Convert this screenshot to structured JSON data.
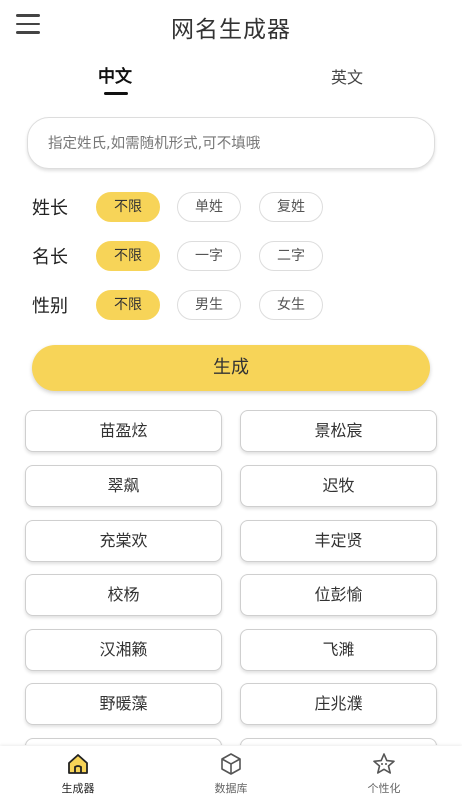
{
  "header": {
    "title": "网名生成器"
  },
  "tabs": [
    {
      "label": "中文"
    },
    {
      "label": "英文"
    }
  ],
  "search": {
    "placeholder": "指定姓氏,如需随机形式,可不填哦",
    "value": ""
  },
  "options": [
    {
      "label": "姓长",
      "choices": [
        "不限",
        "单姓",
        "复姓"
      ],
      "selected": "不限"
    },
    {
      "label": "名长",
      "choices": [
        "不限",
        "一字",
        "二字"
      ],
      "selected": "不限"
    },
    {
      "label": "性别",
      "choices": [
        "不限",
        "男生",
        "女生"
      ],
      "selected": "不限"
    }
  ],
  "generate_label": "生成",
  "names": [
    "苗盈炫",
    "景松宸",
    "翠飙",
    "迟牧",
    "充棠欢",
    "丰定贤",
    "校杨",
    "位彭愉",
    "汉湘籁",
    "飞濉",
    "野暖藻",
    "庄兆濮",
    "",
    ""
  ],
  "bottom_nav": [
    {
      "label": "生成器",
      "icon": "home-icon",
      "active": true
    },
    {
      "label": "数据库",
      "icon": "database-icon",
      "active": false
    },
    {
      "label": "个性化",
      "icon": "star-icon",
      "active": false
    }
  ],
  "colors": {
    "accent": "#f7d458",
    "accent_dark": "#e9b800"
  }
}
